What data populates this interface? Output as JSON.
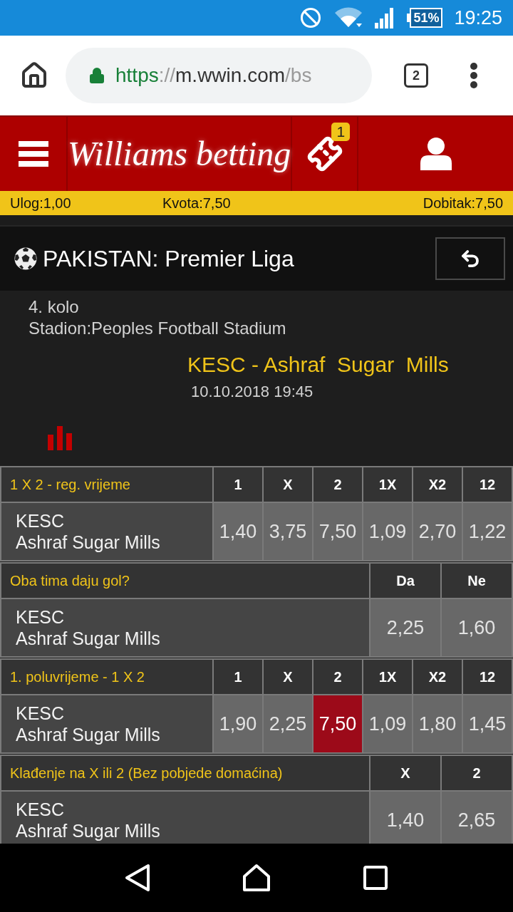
{
  "status_bar": {
    "battery": "51%",
    "time": "19:25"
  },
  "browser": {
    "url": {
      "scheme": "https",
      "separator": "://",
      "host": "m.wwin.com",
      "path": "/bs"
    },
    "tab_count": "2"
  },
  "header": {
    "logo": "Williams betting",
    "ticket_badge": "1"
  },
  "bet_summary": {
    "stake": "Ulog:1,00",
    "odds": "Kvota:7,50",
    "payout": "Dobitak:7,50"
  },
  "league": {
    "title": "PAKISTAN: Premier Liga"
  },
  "event": {
    "round": "4. kolo",
    "venue": "Stadion:Peoples Football Stadium",
    "match": "KESC - Ashraf  Sugar  Mills",
    "datetime": "10.10.2018 19:45"
  },
  "markets": [
    {
      "title": "1 X 2 - reg. vrijeme",
      "columns": [
        "1",
        "X",
        "2",
        "1X",
        "X2",
        "12"
      ],
      "teams": [
        "KESC",
        "Ashraf Sugar Mills"
      ],
      "odds": [
        {
          "value": "1,40",
          "selected": false
        },
        {
          "value": "3,75",
          "selected": false
        },
        {
          "value": "7,50",
          "selected": false
        },
        {
          "value": "1,09",
          "selected": false
        },
        {
          "value": "2,70",
          "selected": false
        },
        {
          "value": "1,22",
          "selected": false
        }
      ]
    },
    {
      "title": "Oba tima daju gol?",
      "columns": [
        "Da",
        "Ne"
      ],
      "teams": [
        "KESC",
        "Ashraf Sugar Mills"
      ],
      "odds": [
        {
          "value": "2,25",
          "selected": false
        },
        {
          "value": "1,60",
          "selected": false
        }
      ]
    },
    {
      "title": "1. poluvrijeme - 1 X 2",
      "columns": [
        "1",
        "X",
        "2",
        "1X",
        "X2",
        "12"
      ],
      "teams": [
        "KESC",
        "Ashraf Sugar Mills"
      ],
      "odds": [
        {
          "value": "1,90",
          "selected": false
        },
        {
          "value": "2,25",
          "selected": false
        },
        {
          "value": "7,50",
          "selected": true
        },
        {
          "value": "1,09",
          "selected": false
        },
        {
          "value": "1,80",
          "selected": false
        },
        {
          "value": "1,45",
          "selected": false
        }
      ]
    },
    {
      "title": "Klađenje na X ili 2 (Bez pobjede domaćina)",
      "columns": [
        "X",
        "2"
      ],
      "teams": [
        "KESC",
        "Ashraf Sugar Mills"
      ],
      "odds": [
        {
          "value": "1,40",
          "selected": false
        },
        {
          "value": "2,65",
          "selected": false
        }
      ]
    }
  ]
}
